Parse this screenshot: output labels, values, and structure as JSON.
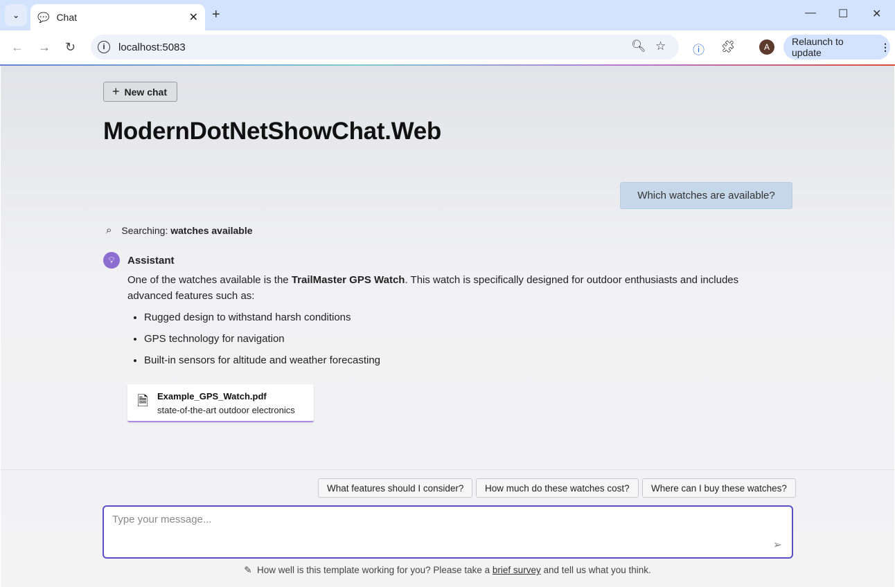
{
  "browser": {
    "tab_title": "Chat",
    "url": "localhost:5083",
    "relaunch_label": "Relaunch to update",
    "avatar_initial": "A"
  },
  "page": {
    "new_chat_label": "New chat",
    "title": "ModernDotNetShowChat.Web",
    "user_message": "Which watches are available?",
    "search_prefix": "Searching:",
    "search_query": "watches available",
    "assistant": {
      "name": "Assistant",
      "intro_1": "One of the watches available is the ",
      "product": "TrailMaster GPS Watch",
      "intro_2": ". This watch is specifically designed for outdoor enthusiasts and includes advanced features such as:",
      "bullets": [
        "Rugged design to withstand harsh conditions",
        "GPS technology for navigation",
        "Built-in sensors for altitude and weather forecasting"
      ]
    },
    "citation": {
      "file": "Example_GPS_Watch.pdf",
      "quote": "state-of-the-art outdoor electronics"
    },
    "suggestions": [
      "What features should I consider?",
      "How much do these watches cost?",
      "Where can I buy these watches?"
    ],
    "input_placeholder": "Type your message...",
    "footer": {
      "pre": "How well is this template working for you? Please take a ",
      "link": "brief survey",
      "post": " and tell us what you think."
    }
  },
  "colors": {
    "accent": "#5b4fc9",
    "assistant_icon": "#8c6ed0",
    "user_bubble": "#c5d7e8"
  }
}
